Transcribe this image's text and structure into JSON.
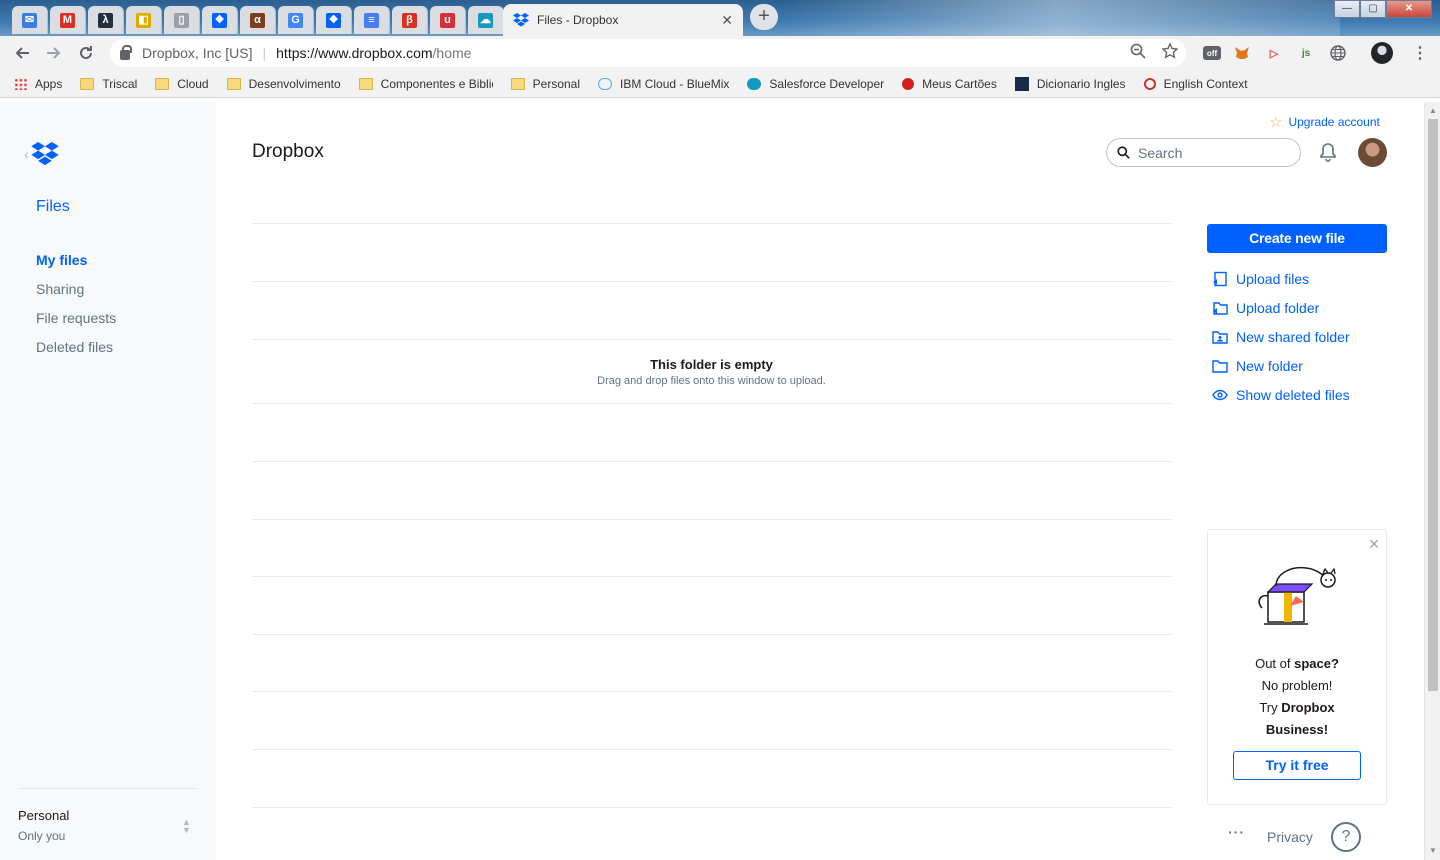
{
  "browser": {
    "pinned_tabs": [
      {
        "name": "mail",
        "color": "#3d7de0",
        "glyph": "✉"
      },
      {
        "name": "gmail",
        "color": "#d93025",
        "glyph": "M"
      },
      {
        "name": "lambda",
        "color": "#232f3e",
        "glyph": "λ"
      },
      {
        "name": "keep",
        "color": "#e0a800",
        "glyph": "◧"
      },
      {
        "name": "doc",
        "color": "#9aa0a6",
        "glyph": "▯"
      },
      {
        "name": "dropbox",
        "color": "#0061fe",
        "glyph": "❖"
      },
      {
        "name": "alura",
        "color": "#7b3f1e",
        "glyph": "α"
      },
      {
        "name": "google",
        "color": "#4285f4",
        "glyph": "G"
      },
      {
        "name": "dropbox2",
        "color": "#0061fe",
        "glyph": "❖"
      },
      {
        "name": "docs",
        "color": "#4a7ef0",
        "glyph": "≡"
      },
      {
        "name": "pbs",
        "color": "#d93025",
        "glyph": "β"
      },
      {
        "name": "udemy",
        "color": "#d4303a",
        "glyph": "u"
      },
      {
        "name": "salesforce",
        "color": "#1798c1",
        "glyph": "☁"
      }
    ],
    "active_tab": {
      "title": "Files - Dropbox",
      "close": "✕"
    },
    "new_tab": "+",
    "window_buttons": {
      "minimize": "—",
      "maximize": "▢",
      "close": "✕"
    },
    "address": {
      "org": "Dropbox, Inc [US]",
      "url_host": "https://www.dropbox.com",
      "url_path": "/home"
    },
    "omnibox_icons": [
      "zoom-icon",
      "star-icon"
    ],
    "extensions": [
      "off",
      "fox",
      "▷",
      "js",
      "globe"
    ],
    "bookmarks": [
      {
        "label": "Apps",
        "type": "apps"
      },
      {
        "label": "Triscal",
        "type": "folder"
      },
      {
        "label": "Cloud",
        "type": "folder"
      },
      {
        "label": "Desenvolvimento",
        "type": "folder"
      },
      {
        "label": "Componentes e Biblio",
        "type": "folder"
      },
      {
        "label": "Personal",
        "type": "folder"
      },
      {
        "label": "IBM Cloud - BlueMix",
        "type": "cloud"
      },
      {
        "label": "Salesforce Developer",
        "type": "salesforce"
      },
      {
        "label": "Meus Cartões",
        "type": "red"
      },
      {
        "label": "Dicionario Ingles",
        "type": "dict"
      },
      {
        "label": "English Context",
        "type": "context"
      }
    ]
  },
  "sidebar": {
    "back": "‹",
    "files": "Files",
    "nav": [
      "My files",
      "Sharing",
      "File requests",
      "Deleted files"
    ],
    "account_name": "Personal",
    "account_sub": "Only you",
    "switcher": "⌃⌄"
  },
  "header": {
    "title": "Dropbox",
    "upgrade": "Upgrade account",
    "search_placeholder": "Search"
  },
  "content": {
    "empty_title": "This folder is empty",
    "empty_subtitle": "Drag and drop files onto this window to upload."
  },
  "actions": {
    "create": "Create new file",
    "items": [
      "Upload files",
      "Upload folder",
      "New shared folder",
      "New folder",
      "Show deleted files"
    ]
  },
  "promo": {
    "close": "✕",
    "line1_a": "Out of ",
    "line1_b": "space?",
    "line2": "No problem!",
    "line3_a": "Try ",
    "line3_b": "Dropbox",
    "line4": "Business!",
    "button": "Try it free"
  },
  "footer": {
    "more": "···",
    "privacy": "Privacy",
    "help": "?"
  },
  "colors": {
    "accent": "#0061fe",
    "sidebar_bg": "#f7f9fa",
    "muted_text": "#637282"
  }
}
